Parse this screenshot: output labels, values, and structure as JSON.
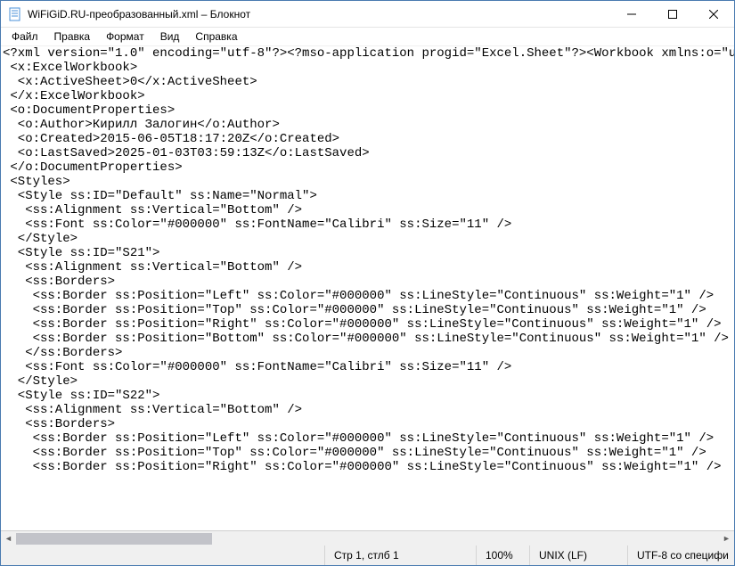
{
  "window": {
    "title": "WiFiGiD.RU-преобразованный.xml – Блокнот"
  },
  "menu": {
    "file": "Файл",
    "edit": "Правка",
    "format": "Формат",
    "view": "Вид",
    "help": "Справка"
  },
  "content": "<?xml version=\"1.0\" encoding=\"utf-8\"?><?mso-application progid=\"Excel.Sheet\"?><Workbook xmlns:o=\"urn\n <x:ExcelWorkbook>\n  <x:ActiveSheet>0</x:ActiveSheet>\n </x:ExcelWorkbook>\n <o:DocumentProperties>\n  <o:Author>Кирилл Залогин</o:Author>\n  <o:Created>2015-06-05T18:17:20Z</o:Created>\n  <o:LastSaved>2025-01-03T03:59:13Z</o:LastSaved>\n </o:DocumentProperties>\n <Styles>\n  <Style ss:ID=\"Default\" ss:Name=\"Normal\">\n   <ss:Alignment ss:Vertical=\"Bottom\" />\n   <ss:Font ss:Color=\"#000000\" ss:FontName=\"Calibri\" ss:Size=\"11\" />\n  </Style>\n  <Style ss:ID=\"S21\">\n   <ss:Alignment ss:Vertical=\"Bottom\" />\n   <ss:Borders>\n    <ss:Border ss:Position=\"Left\" ss:Color=\"#000000\" ss:LineStyle=\"Continuous\" ss:Weight=\"1\" />\n    <ss:Border ss:Position=\"Top\" ss:Color=\"#000000\" ss:LineStyle=\"Continuous\" ss:Weight=\"1\" />\n    <ss:Border ss:Position=\"Right\" ss:Color=\"#000000\" ss:LineStyle=\"Continuous\" ss:Weight=\"1\" />\n    <ss:Border ss:Position=\"Bottom\" ss:Color=\"#000000\" ss:LineStyle=\"Continuous\" ss:Weight=\"1\" />\n   </ss:Borders>\n   <ss:Font ss:Color=\"#000000\" ss:FontName=\"Calibri\" ss:Size=\"11\" />\n  </Style>\n  <Style ss:ID=\"S22\">\n   <ss:Alignment ss:Vertical=\"Bottom\" />\n   <ss:Borders>\n    <ss:Border ss:Position=\"Left\" ss:Color=\"#000000\" ss:LineStyle=\"Continuous\" ss:Weight=\"1\" />\n    <ss:Border ss:Position=\"Top\" ss:Color=\"#000000\" ss:LineStyle=\"Continuous\" ss:Weight=\"1\" />\n    <ss:Border ss:Position=\"Right\" ss:Color=\"#000000\" ss:LineStyle=\"Continuous\" ss:Weight=\"1\" />",
  "status": {
    "position": "Стр 1, стлб 1",
    "zoom": "100%",
    "line_ending": "UNIX (LF)",
    "encoding": "UTF-8 со специфи"
  }
}
